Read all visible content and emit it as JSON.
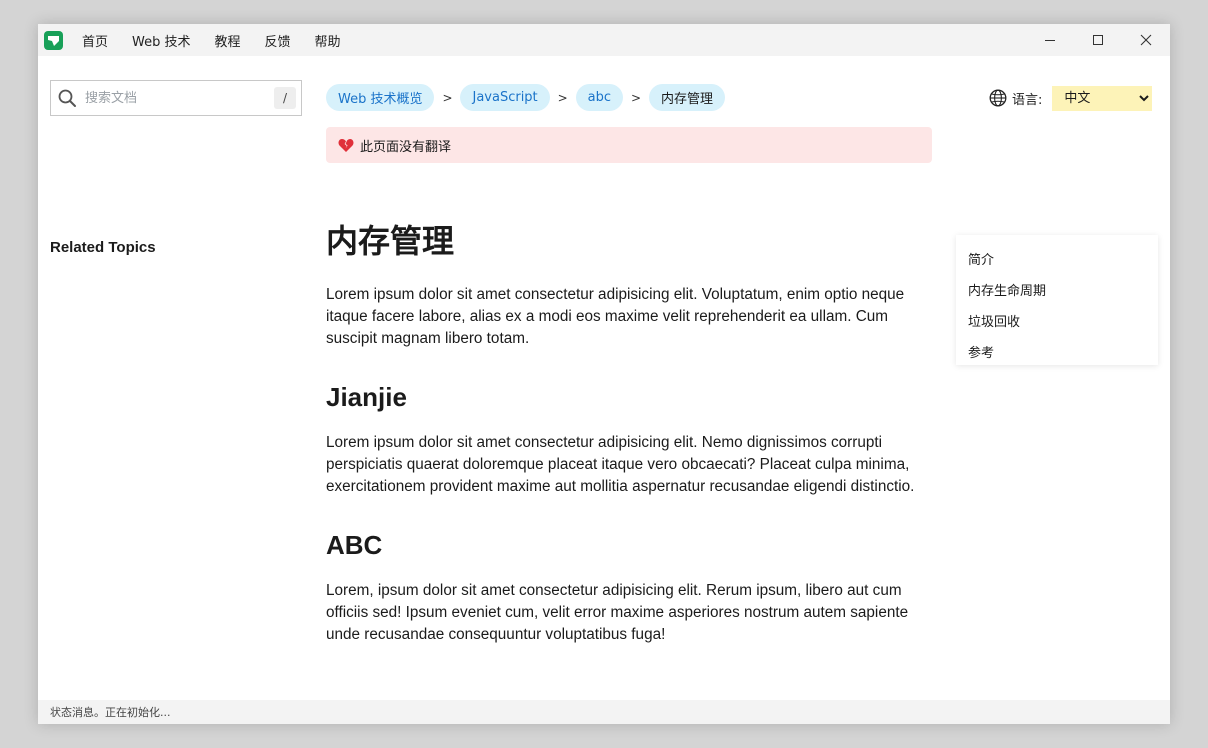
{
  "titlebar": {
    "logo_icon": "app-logo-icon",
    "menu": [
      "首页",
      "Web 技术",
      "教程",
      "反馈",
      "帮助"
    ]
  },
  "search": {
    "placeholder": "搜索文档",
    "shortcut": "/"
  },
  "sidebar": {
    "related_title": "Related Topics"
  },
  "breadcrumb": [
    "Web 技术概览",
    "JavaScript",
    "abc",
    "内存管理"
  ],
  "breadcrumb_separator": ">",
  "language": {
    "label": "语言:",
    "selected": "中文"
  },
  "notice": {
    "text": "此页面没有翻译"
  },
  "article": {
    "title": "内存管理",
    "intro": "Lorem ipsum dolor sit amet consectetur adipisicing elit. Voluptatum, enim optio neque itaque facere labore, alias ex a modi eos maxime velit reprehenderit ea ullam. Cum suscipit magnam libero totam.",
    "sections": [
      {
        "heading": "Jianjie",
        "body": "Lorem ipsum dolor sit amet consectetur adipisicing elit. Nemo dignissimos corrupti perspiciatis quaerat doloremque placeat itaque vero obcaecati? Placeat culpa minima, exercitationem provident maxime aut mollitia aspernatur recusandae eligendi distinctio."
      },
      {
        "heading": "ABC",
        "body": "Lorem, ipsum dolor sit amet consectetur adipisicing elit. Rerum ipsum, libero aut cum officiis sed! Ipsum eveniet cum, velit error maxime asperiores nostrum autem sapiente unde recusandae consequuntur voluptatibus fuga!"
      }
    ]
  },
  "toc": [
    "简介",
    "内存生命周期",
    "垃圾回收",
    "参考"
  ],
  "statusbar": {
    "text": "状态消息。正在初始化..."
  },
  "colors": {
    "accent": "#1a73c9",
    "crumb_bg": "#d7f1fb",
    "notice_bg": "#fde6e6",
    "lang_bg": "#fdf3b8",
    "logo": "#18a058"
  }
}
